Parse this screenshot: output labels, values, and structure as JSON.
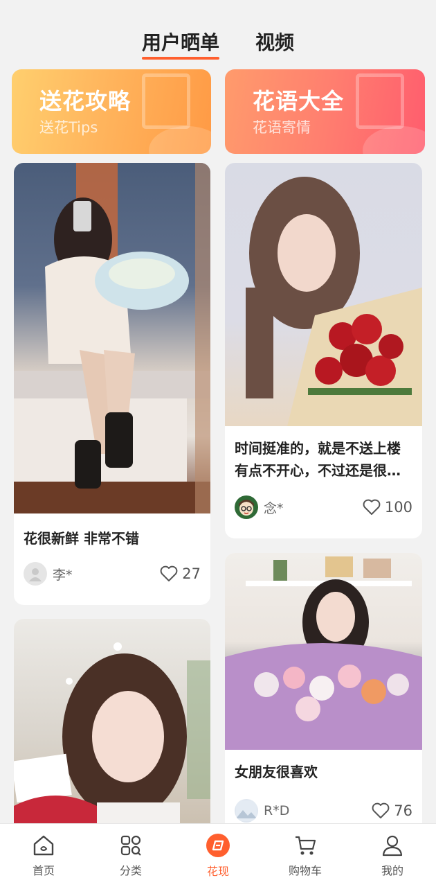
{
  "tabs": [
    {
      "label": "用户晒单",
      "active": true
    },
    {
      "label": "视频",
      "active": false
    }
  ],
  "banners": [
    {
      "title": "送花攻略",
      "subtitle": "送花Tips"
    },
    {
      "title": "花语大全",
      "subtitle": "花语寄情"
    }
  ],
  "posts": [
    {
      "title": "花很新鲜 非常不错",
      "user": "李*",
      "likes": "27"
    },
    {
      "title": "时间挺准的，就是不送上楼有点不开心，不过还是很…",
      "user": "念*",
      "likes": "100"
    },
    {
      "title": "女朋友很喜欢",
      "user": "R*D",
      "likes": "76"
    },
    {
      "title": "",
      "user": "",
      "likes": ""
    }
  ],
  "nav": [
    {
      "label": "首页",
      "icon": "home-icon"
    },
    {
      "label": "分类",
      "icon": "category-icon"
    },
    {
      "label": "花现",
      "icon": "discover-icon",
      "active": true
    },
    {
      "label": "购物车",
      "icon": "cart-icon"
    },
    {
      "label": "我的",
      "icon": "profile-icon"
    }
  ],
  "colors": {
    "accent": "#ff5f2e",
    "banner1": "#ffb55d",
    "banner2": "#ff7f6f"
  }
}
